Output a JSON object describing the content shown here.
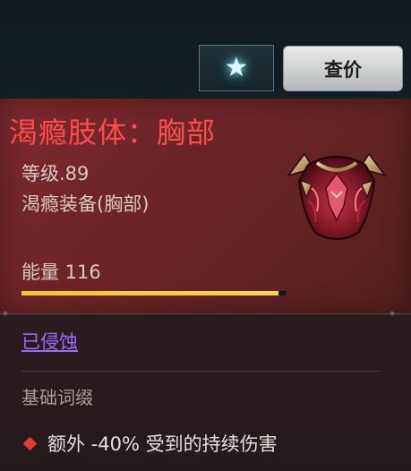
{
  "toolbar": {
    "favorite_icon": "star-icon",
    "price_button_label": "查价"
  },
  "item": {
    "name": "渴瘾肢体：胸部",
    "level": "等级.89",
    "type": "渴瘾装备(胸部)",
    "icon": "chest-armor-icon",
    "energy_label": "能量 116",
    "energy_fraction": 0.97,
    "status_link": "已侵蚀",
    "base_affix_title": "基础词缀",
    "affixes": [
      {
        "icon": "diamond-icon",
        "text": "额外 -40% 受到的持续伤害"
      }
    ]
  },
  "colors": {
    "item_name": "#ff4d4a",
    "corrupted_link": "#9a6bff",
    "energy_bar": "#f2c43a",
    "affix_diamond": "#e03a33"
  }
}
